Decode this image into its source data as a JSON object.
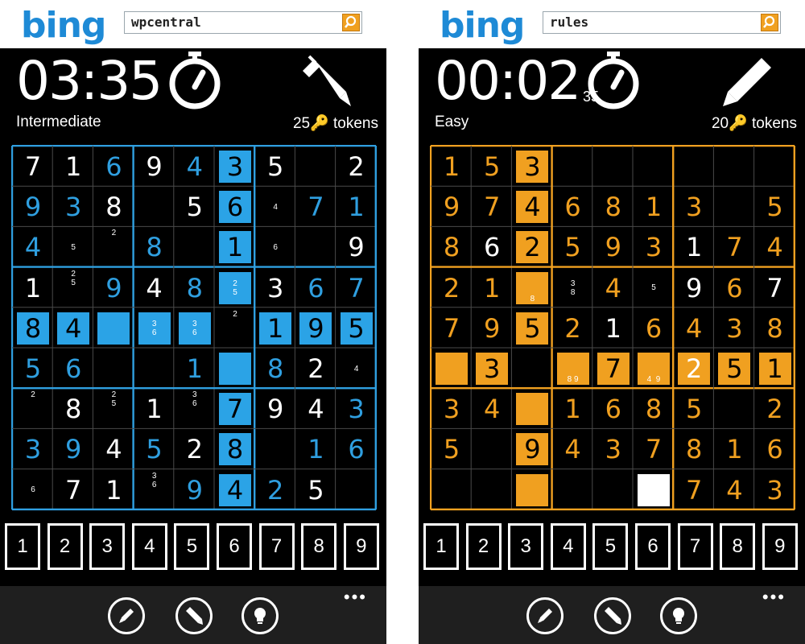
{
  "screens": [
    {
      "search_value": "wpcentral",
      "logo": "bing",
      "timer": "03:35",
      "timer_seconds": "",
      "difficulty": "Intermediate",
      "tokens": "25🔑 tokens",
      "accent_color": "#2f9fe0",
      "highlight_color": "#2ba3e6",
      "grid": [
        [
          [
            "7",
            "w"
          ],
          [
            "1",
            "w"
          ],
          [
            "6",
            "a"
          ],
          [
            "9",
            "w"
          ],
          [
            "4",
            "a"
          ],
          [
            "3",
            "h"
          ],
          [
            "5",
            "w"
          ],
          [
            "",
            ""
          ],
          [
            "2",
            "w"
          ]
        ],
        [
          [
            "9",
            "a"
          ],
          [
            "3",
            "a"
          ],
          [
            "8",
            "w"
          ],
          [
            "",
            ""
          ],
          [
            "5",
            "w"
          ],
          [
            "6",
            "h"
          ],
          [
            "4",
            "n"
          ],
          [
            "7",
            "a"
          ],
          [
            "1",
            "a"
          ]
        ],
        [
          [
            "4",
            "a"
          ],
          [
            "5",
            "n"
          ],
          [
            "2",
            "nt"
          ],
          [
            "8",
            "a"
          ],
          [
            "",
            ""
          ],
          [
            "1",
            "h"
          ],
          [
            "6",
            "n"
          ],
          [
            "",
            ""
          ],
          [
            "9",
            "w"
          ]
        ],
        [
          [
            "1",
            "w"
          ],
          [
            "2\n5",
            "nt"
          ],
          [
            "9",
            "a"
          ],
          [
            "4",
            "w"
          ],
          [
            "8",
            "a"
          ],
          [
            "2\n5",
            "hn"
          ],
          [
            "3",
            "w"
          ],
          [
            "6",
            "a"
          ],
          [
            "7",
            "a"
          ]
        ],
        [
          [
            "8",
            "h"
          ],
          [
            "4",
            "h"
          ],
          [
            "",
            "h"
          ],
          [
            "3\n6",
            "hn"
          ],
          [
            "3\n6",
            "hn"
          ],
          [
            "2",
            "nt"
          ],
          [
            "1",
            "h"
          ],
          [
            "9",
            "h"
          ],
          [
            "5",
            "h"
          ]
        ],
        [
          [
            "5",
            "a"
          ],
          [
            "6",
            "a"
          ],
          [
            "",
            ""
          ],
          [
            "",
            ""
          ],
          [
            "1",
            "a"
          ],
          [
            "",
            "h"
          ],
          [
            "8",
            "a"
          ],
          [
            "2",
            "w"
          ],
          [
            "4",
            "n"
          ]
        ],
        [
          [
            "2",
            "nt"
          ],
          [
            "8",
            "w"
          ],
          [
            "2\n5",
            "nt"
          ],
          [
            "1",
            "w"
          ],
          [
            "3\n6",
            "nt"
          ],
          [
            "7",
            "h"
          ],
          [
            "9",
            "w"
          ],
          [
            "4",
            "w"
          ],
          [
            "3",
            "a"
          ]
        ],
        [
          [
            "3",
            "a"
          ],
          [
            "9",
            "a"
          ],
          [
            "4",
            "w"
          ],
          [
            "5",
            "a"
          ],
          [
            "2",
            "w"
          ],
          [
            "8",
            "h"
          ],
          [
            "",
            ""
          ],
          [
            "1",
            "a"
          ],
          [
            "6",
            "a"
          ]
        ],
        [
          [
            "6",
            "n"
          ],
          [
            "7",
            "w"
          ],
          [
            "1",
            "w"
          ],
          [
            "3\n6",
            "nt"
          ],
          [
            "9",
            "a"
          ],
          [
            "4",
            "h"
          ],
          [
            "2",
            "a"
          ],
          [
            "5",
            "w"
          ],
          [
            "",
            ""
          ]
        ]
      ]
    },
    {
      "search_value": "rules",
      "logo": "bing",
      "timer": "00:02",
      "timer_seconds": "35",
      "difficulty": "Easy",
      "tokens": "20🔑 tokens",
      "accent_color": "#f0a020",
      "highlight_color": "#f0a020",
      "grid": [
        [
          [
            "1",
            "a"
          ],
          [
            "5",
            "a"
          ],
          [
            "3",
            "h"
          ],
          [
            "",
            ""
          ],
          [
            "",
            ""
          ],
          [
            "",
            ""
          ],
          [
            "",
            ""
          ],
          [
            "",
            ""
          ],
          [
            "",
            ""
          ]
        ],
        [
          [
            "9",
            "a"
          ],
          [
            "7",
            "a"
          ],
          [
            "4",
            "h"
          ],
          [
            "6",
            "a"
          ],
          [
            "8",
            "a"
          ],
          [
            "1",
            "a"
          ],
          [
            "3",
            "a"
          ],
          [
            "",
            ""
          ],
          [
            "5",
            "a"
          ]
        ],
        [
          [
            "8",
            "a"
          ],
          [
            "6",
            "w"
          ],
          [
            "2",
            "h"
          ],
          [
            "5",
            "a"
          ],
          [
            "9",
            "a"
          ],
          [
            "3",
            "a"
          ],
          [
            "1",
            "w"
          ],
          [
            "7",
            "a"
          ],
          [
            "4",
            "a"
          ]
        ],
        [
          [
            "2",
            "a"
          ],
          [
            "1",
            "a"
          ],
          [
            "8",
            "hn"
          ],
          [
            "3\n8",
            "n"
          ],
          [
            "4",
            "a"
          ],
          [
            "5",
            "n"
          ],
          [
            "9",
            "w"
          ],
          [
            "6",
            "a"
          ],
          [
            "7",
            "w"
          ]
        ],
        [
          [
            "7",
            "a"
          ],
          [
            "9",
            "a"
          ],
          [
            "5",
            "h"
          ],
          [
            "2",
            "a"
          ],
          [
            "1",
            "w"
          ],
          [
            "6",
            "a"
          ],
          [
            "4",
            "a"
          ],
          [
            "3",
            "a"
          ],
          [
            "8",
            "a"
          ]
        ],
        [
          [
            "",
            "h"
          ],
          [
            "3",
            "h"
          ],
          [
            "",
            ""
          ],
          [
            "8 9",
            "hn"
          ],
          [
            "7",
            "h"
          ],
          [
            "4  9",
            "hn"
          ],
          [
            "2",
            "hw"
          ],
          [
            "5",
            "h"
          ],
          [
            "1",
            "h"
          ]
        ],
        [
          [
            "3",
            "a"
          ],
          [
            "4",
            "a"
          ],
          [
            "",
            "h"
          ],
          [
            "1",
            "a"
          ],
          [
            "6",
            "a"
          ],
          [
            "8",
            "a"
          ],
          [
            "5",
            "a"
          ],
          [
            "",
            ""
          ],
          [
            "2",
            "a"
          ]
        ],
        [
          [
            "5",
            "a"
          ],
          [
            "",
            ""
          ],
          [
            "9",
            "h"
          ],
          [
            "4",
            "a"
          ],
          [
            "3",
            "a"
          ],
          [
            "7",
            "a"
          ],
          [
            "8",
            "a"
          ],
          [
            "1",
            "a"
          ],
          [
            "6",
            "a"
          ]
        ],
        [
          [
            "",
            ""
          ],
          [
            "",
            ""
          ],
          [
            "",
            "h"
          ],
          [
            "",
            ""
          ],
          [
            "",
            ""
          ],
          [
            "",
            "sel"
          ],
          [
            "7",
            "a"
          ],
          [
            "4",
            "a"
          ],
          [
            "3",
            "a"
          ]
        ]
      ]
    }
  ],
  "numpad": [
    "1",
    "2",
    "3",
    "4",
    "5",
    "6",
    "7",
    "8",
    "9"
  ],
  "appbar": {
    "buttons": [
      "pencil-icon",
      "marker-icon",
      "lightbulb-icon"
    ],
    "more_label": "•••"
  }
}
